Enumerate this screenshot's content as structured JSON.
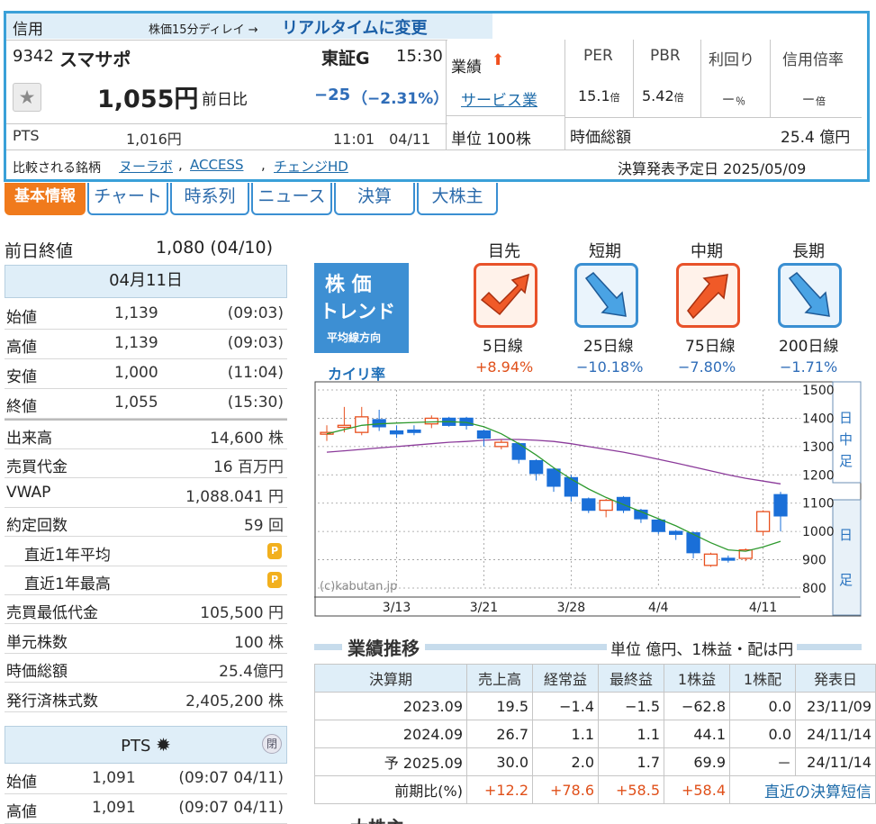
{
  "header": {
    "credit_label": "信用",
    "delay_note": "株価15分ディレイ →",
    "realtime_link": "リアルタイムに変更",
    "code": "9342",
    "name": "スマサポ",
    "market": "東証G",
    "time": "15:30",
    "price": "1,055円",
    "change_label": "前日比",
    "change": "−25",
    "change_pct": "（−2.31%）",
    "pts_label": "PTS",
    "pts_price": "1,016円",
    "pts_time": "11:01　04/11",
    "performance_label": "業績",
    "industry": "サービス業",
    "unit": "単位 100株",
    "per_label": "PER",
    "pbr_label": "PBR",
    "yield_label": "利回り",
    "margin_label": "信用倍率",
    "per_value": "15.1",
    "per_unit": "倍",
    "pbr_value": "5.42",
    "pbr_unit": "倍",
    "yield_value": "－",
    "yield_unit": "％",
    "margin_value": "－",
    "margin_unit": "倍",
    "mcap_label": "時価総額",
    "mcap_value": "25.4 億円",
    "compare_label": "比較される銘柄",
    "compare_1": "ヌーラボ",
    "compare_2": "ACCESS",
    "compare_3": "チェンジHD",
    "earnings_date": "決算発表予定日  2025/05/09"
  },
  "tabs": [
    "基本情報",
    "チャート",
    "時系列",
    "ニュース",
    "決算",
    "大株主"
  ],
  "left": {
    "prev_close_label": "前日終値",
    "prev_close_value": "1,080 (04/10)",
    "date_header": "04月11日",
    "ohlc": [
      {
        "label": "始値",
        "value": "1,139",
        "time": "(09:03)"
      },
      {
        "label": "高値",
        "value": "1,139",
        "time": "(09:03)"
      },
      {
        "label": "安値",
        "value": "1,000",
        "time": "(11:04)"
      },
      {
        "label": "終値",
        "value": "1,055",
        "time": "(15:30)"
      }
    ],
    "stats": [
      {
        "label": "出来高",
        "value": "14,600 株"
      },
      {
        "label": "売買代金",
        "value": "16 百万円"
      },
      {
        "label": "VWAP",
        "value": "1,088.041 円"
      },
      {
        "label": "約定回数",
        "value": "59 回"
      },
      {
        "label": "直近1年平均",
        "value": ""
      },
      {
        "label": "直近1年最高",
        "value": ""
      },
      {
        "label": "売買最低代金",
        "value": "105,500 円"
      },
      {
        "label": "単元株数",
        "value": "100 株"
      },
      {
        "label": "時価総額",
        "value": "25.4億円"
      },
      {
        "label": "発行済株式数",
        "value": "2,405,200 株"
      }
    ],
    "pts_header": "PTS",
    "pts_close": "閉",
    "pts_rows": [
      {
        "label": "始値",
        "value": "1,091",
        "time": "(09:07  04/11)"
      },
      {
        "label": "高値",
        "value": "1,091",
        "time": "(09:07  04/11)"
      }
    ]
  },
  "trend": {
    "logo_line1": "株 価",
    "logo_line2": "トレンド",
    "logo_line3": "平均線方向",
    "kairi_label": "カイリ率",
    "columns": [
      {
        "title": "目先",
        "line": "5日線",
        "rate": "+8.94%",
        "dir": "up-check",
        "color": "#e8522a"
      },
      {
        "title": "短期",
        "line": "25日線",
        "rate": "−10.18%",
        "dir": "down",
        "color": "#3a8fd2"
      },
      {
        "title": "中期",
        "line": "75日線",
        "rate": "−7.80%",
        "dir": "up",
        "color": "#e8522a"
      },
      {
        "title": "長期",
        "line": "200日線",
        "rate": "−1.71%",
        "dir": "down",
        "color": "#3a8fd2"
      }
    ]
  },
  "chart_data": {
    "type": "candlestick",
    "watermark": "(c)kabutan.jp",
    "ylim": [
      800,
      1500
    ],
    "yticks": [
      "1500",
      "1400",
      "1300",
      "1200",
      "1100",
      "1000",
      "900",
      "800"
    ],
    "xticks": [
      "3/13",
      "3/21",
      "3/28",
      "4/4",
      "4/11"
    ],
    "side_labels_top": [
      "日",
      "中",
      "足"
    ],
    "side_labels_bottom": [
      "日",
      "足"
    ],
    "candles": [
      {
        "o": 1345,
        "c": 1350,
        "h": 1375,
        "l": 1320
      },
      {
        "o": 1368,
        "c": 1375,
        "h": 1440,
        "l": 1350
      },
      {
        "o": 1350,
        "c": 1405,
        "h": 1440,
        "l": 1340
      },
      {
        "o": 1395,
        "c": 1370,
        "h": 1430,
        "l": 1355
      },
      {
        "o": 1355,
        "c": 1345,
        "h": 1375,
        "l": 1330
      },
      {
        "o": 1358,
        "c": 1350,
        "h": 1375,
        "l": 1340
      },
      {
        "o": 1380,
        "c": 1400,
        "h": 1410,
        "l": 1365
      },
      {
        "o": 1400,
        "c": 1375,
        "h": 1405,
        "l": 1370
      },
      {
        "o": 1400,
        "c": 1375,
        "h": 1405,
        "l": 1360
      },
      {
        "o": 1355,
        "c": 1330,
        "h": 1360,
        "l": 1300
      },
      {
        "o": 1300,
        "c": 1315,
        "h": 1325,
        "l": 1290
      },
      {
        "o": 1310,
        "c": 1255,
        "h": 1315,
        "l": 1240
      },
      {
        "o": 1250,
        "c": 1205,
        "h": 1255,
        "l": 1180
      },
      {
        "o": 1220,
        "c": 1160,
        "h": 1225,
        "l": 1140
      },
      {
        "o": 1190,
        "c": 1125,
        "h": 1200,
        "l": 1105
      },
      {
        "o": 1115,
        "c": 1075,
        "h": 1120,
        "l": 1065
      },
      {
        "o": 1075,
        "c": 1110,
        "h": 1115,
        "l": 1050
      },
      {
        "o": 1120,
        "c": 1075,
        "h": 1125,
        "l": 1065
      },
      {
        "o": 1075,
        "c": 1045,
        "h": 1080,
        "l": 1030
      },
      {
        "o": 1040,
        "c": 1000,
        "h": 1045,
        "l": 990
      },
      {
        "o": 1000,
        "c": 990,
        "h": 1005,
        "l": 970
      },
      {
        "o": 995,
        "c": 925,
        "h": 1000,
        "l": 905
      },
      {
        "o": 880,
        "c": 920,
        "h": 925,
        "l": 875
      },
      {
        "o": 905,
        "c": 900,
        "h": 915,
        "l": 890
      },
      {
        "o": 905,
        "c": 935,
        "h": 940,
        "l": 895
      },
      {
        "o": 1000,
        "c": 1070,
        "h": 1075,
        "l": 985
      },
      {
        "o": 1130,
        "c": 1055,
        "h": 1140,
        "l": 1000
      }
    ],
    "ma_green": [
      1345,
      1360,
      1375,
      1380,
      1383,
      1385,
      1387,
      1388,
      1385,
      1370,
      1345,
      1310,
      1270,
      1225,
      1185,
      1150,
      1120,
      1095,
      1070,
      1045,
      1020,
      990,
      960,
      935,
      930,
      945,
      965
    ],
    "ma_purple": [
      1280,
      1285,
      1290,
      1295,
      1300,
      1305,
      1310,
      1315,
      1318,
      1322,
      1325,
      1325,
      1322,
      1318,
      1310,
      1300,
      1290,
      1280,
      1268,
      1255,
      1242,
      1228,
      1214,
      1200,
      1188,
      1178,
      1168
    ]
  },
  "perf": {
    "title": "業績推移",
    "unit_note": "単位 億円、1株益・配は円",
    "headers": [
      "決算期",
      "売上高",
      "経常益",
      "最終益",
      "1株益",
      "1株配",
      "発表日"
    ],
    "rows": [
      [
        "2023.09",
        "19.5",
        "−1.4",
        "−1.5",
        "−62.8",
        "0.0",
        "23/11/09"
      ],
      [
        "2024.09",
        "26.7",
        "1.1",
        "1.1",
        "44.1",
        "0.0",
        "24/11/14"
      ],
      [
        "予 2025.09",
        "30.0",
        "2.0",
        "1.7",
        "69.9",
        "－",
        "24/11/14"
      ]
    ],
    "ratio_label": "前期比(%)",
    "ratio_values": [
      "+12.2",
      "+78.6",
      "+58.5",
      "+58.4"
    ],
    "tanshin_link": "直近の決算短信"
  },
  "bottom_hint": "大株主"
}
